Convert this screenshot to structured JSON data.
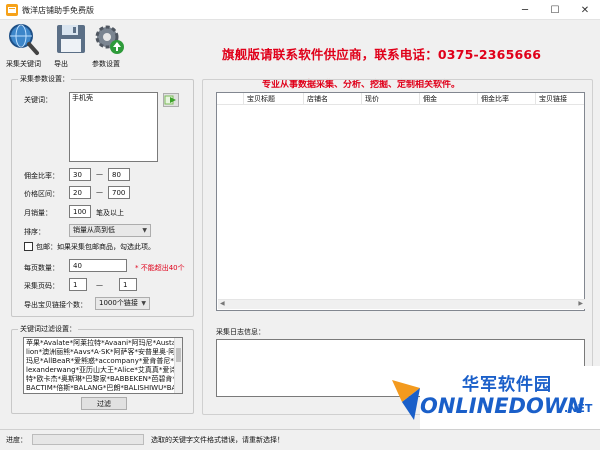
{
  "window": {
    "title": "微洋店铺助手免费版",
    "controls": {
      "minimize": "─",
      "maximize": "☐",
      "close": "✕"
    }
  },
  "toolbar": {
    "items": [
      {
        "label": "采集关键词",
        "icon": "magnifier-globe-icon"
      },
      {
        "label": "导出",
        "icon": "floppy-disk-icon"
      },
      {
        "label": "参数设置",
        "icon": "gear-upload-icon"
      }
    ],
    "headline": "旗舰版请联系软件供应商，联系电话：0375-2365666",
    "subheadline": "专业从事数据采集、分析、挖掘、定制相关软件。"
  },
  "params": {
    "group_title": "采集参数设置：",
    "keyword_label": "关键词：",
    "keyword_value": "手机壳",
    "commission_ratio_label": "佣金比率：",
    "commission_min": "30",
    "commission_max": "80",
    "price_range_label": "价格区间：",
    "price_min": "20",
    "price_max": "700",
    "monthly_sales_label": "月销量：",
    "monthly_sales_value": "100",
    "monthly_sales_suffix": "笔及以上",
    "sort_label": "排序：",
    "sort_value": "销量从高到低",
    "free_shipping_label": "包邮：如果采集包邮商品，勾选此项。",
    "per_page_label": "每页数量：",
    "per_page_value": "40",
    "per_page_note": "* 不能超出40个",
    "page_label": "采集页码：",
    "page_from": "1",
    "page_to": "1",
    "export_label": "导出宝贝链接个数：",
    "export_value": "1000个链接",
    "range_dash": "—"
  },
  "filter": {
    "group_title": "关键词过滤设置：",
    "text": "苹果*Avalate*阿莱拉特*Avaani*阿玛尼*Austarlion*澳洲丽熊*Aavs*A·SK*阿萨客*安普里奥·阿玛尼*AllBeaR*爱熊惑*accompany*爱肯普尼*Alexanderwang*亚历山大王*Alice*艾真真*爱诗特*欧卡杰*奥斯琳*巴黎家*BABBEKEN*芭碧肯*BACTIM*倍斯*BALANG*巴朗*BALISHIWU*BALLETCLAN*芭蕾世家*BANDICOOT",
    "button": "过滤"
  },
  "results": {
    "columns": [
      "",
      "宝贝标题",
      "店铺名",
      "现价",
      "佣金",
      "佣金比率",
      "宝贝链接"
    ]
  },
  "log": {
    "title": "采集日志信息："
  },
  "status": {
    "progress_label": "进度：",
    "progress": 0,
    "message": "选取的关键字文件格式错误，请重新选择！"
  },
  "watermark": {
    "cn": "华军软件园",
    "en": "ONLINEDOWN",
    "suffix": ".NET"
  },
  "colors": {
    "headline": "#e0001a",
    "note": "#e0001a",
    "watermark_blue": "#1a5fc9"
  }
}
